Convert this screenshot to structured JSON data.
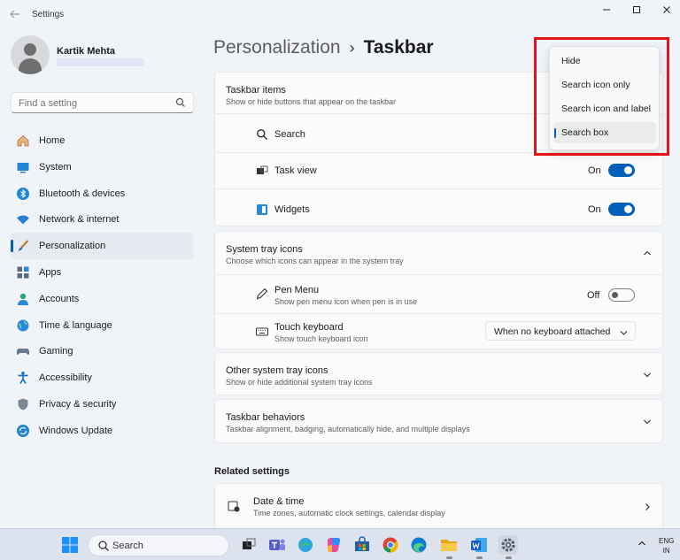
{
  "window": {
    "title": "Settings",
    "controls": [
      "minimize",
      "maximize",
      "close"
    ]
  },
  "profile": {
    "name": "Kartik Mehta"
  },
  "search": {
    "placeholder": "Find a setting"
  },
  "nav": [
    {
      "label": "Home",
      "icon": "home-icon",
      "active": false
    },
    {
      "label": "System",
      "icon": "system-icon",
      "active": false
    },
    {
      "label": "Bluetooth & devices",
      "icon": "bluetooth-icon",
      "active": false
    },
    {
      "label": "Network & internet",
      "icon": "network-icon",
      "active": false
    },
    {
      "label": "Personalization",
      "icon": "brush-icon",
      "active": true
    },
    {
      "label": "Apps",
      "icon": "apps-icon",
      "active": false
    },
    {
      "label": "Accounts",
      "icon": "accounts-icon",
      "active": false
    },
    {
      "label": "Time & language",
      "icon": "globe-icon",
      "active": false
    },
    {
      "label": "Gaming",
      "icon": "gamepad-icon",
      "active": false
    },
    {
      "label": "Accessibility",
      "icon": "accessibility-icon",
      "active": false
    },
    {
      "label": "Privacy & security",
      "icon": "shield-icon",
      "active": false
    },
    {
      "label": "Windows Update",
      "icon": "update-icon",
      "active": false
    }
  ],
  "breadcrumb": {
    "parent": "Personalization",
    "separator": "›",
    "current": "Taskbar"
  },
  "taskbar_items": {
    "title": "Taskbar items",
    "subtitle": "Show or hide buttons that appear on the taskbar",
    "search": {
      "label": "Search"
    },
    "task_view": {
      "label": "Task view",
      "state": "On"
    },
    "widgets": {
      "label": "Widgets",
      "state": "On"
    }
  },
  "search_menu": {
    "options": [
      "Hide",
      "Search icon only",
      "Search icon and label",
      "Search box"
    ],
    "selected": "Search box"
  },
  "system_tray": {
    "title": "System tray icons",
    "subtitle": "Choose which icons can appear in the system tray",
    "pen_menu": {
      "label": "Pen Menu",
      "subtitle": "Show pen menu icon when pen is in use",
      "state": "Off"
    },
    "touch_keyboard": {
      "label": "Touch keyboard",
      "subtitle": "Show touch keyboard icon",
      "value": "When no keyboard attached"
    }
  },
  "other_tray": {
    "title": "Other system tray icons",
    "subtitle": "Show or hide additional system tray icons"
  },
  "behaviors": {
    "title": "Taskbar behaviors",
    "subtitle": "Taskbar alignment, badging, automatically hide, and multiple displays"
  },
  "related": {
    "title": "Related settings",
    "date_time": {
      "label": "Date & time",
      "subtitle": "Time zones, automatic clock settings, calendar display"
    }
  },
  "os_taskbar": {
    "search_label": "Search",
    "lang_top": "ENG",
    "lang_bottom": "IN",
    "apps": [
      "task-view-icon",
      "teams-icon",
      "edge-icon",
      "copilot-icon",
      "store-icon",
      "chrome-icon",
      "edge-browser-icon",
      "file-explorer-icon",
      "word-icon",
      "settings-app-icon"
    ]
  },
  "colors": {
    "accent": "#005fb8",
    "highlight": "#e4141b",
    "background": "#f0f4f9",
    "card": "#fbfbfb"
  }
}
